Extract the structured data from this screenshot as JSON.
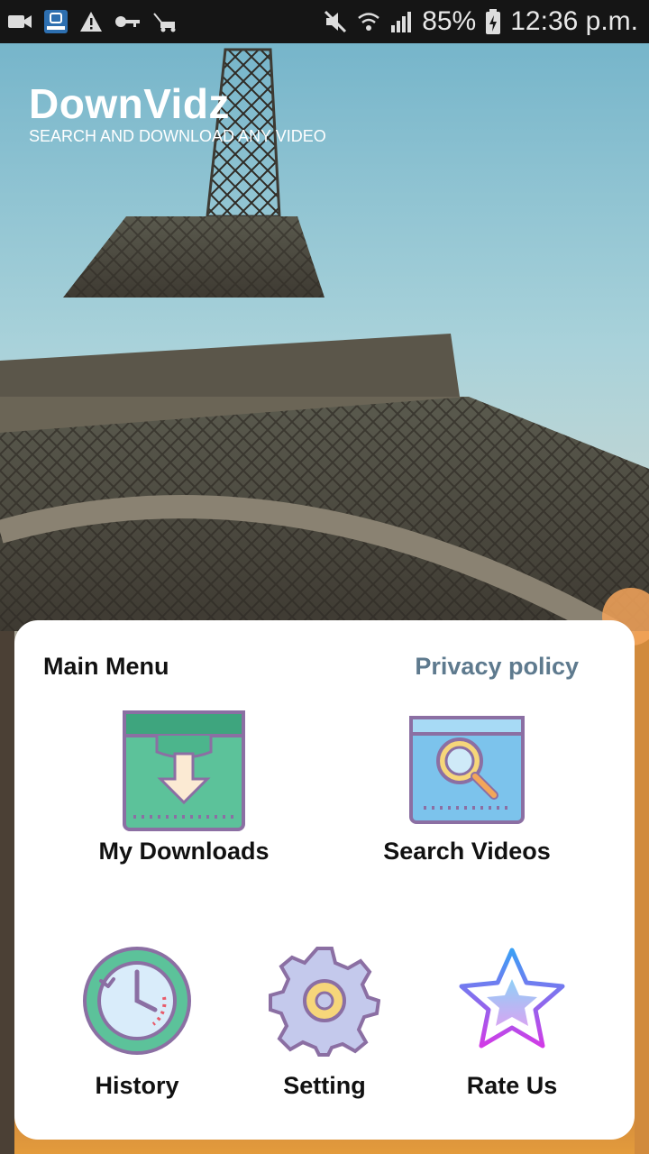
{
  "status_bar": {
    "battery": "85%",
    "time": "12:36 p.m.",
    "icons": [
      "video-camera-icon",
      "insta-app-icon",
      "warning-icon",
      "key-icon",
      "mower-icon",
      "mute-icon",
      "wifi-icon",
      "signal-icon",
      "battery-charging-icon"
    ]
  },
  "app": {
    "title": "DownVidz",
    "subtitle": "SEARCH AND DOWNLOAD ANY VIDEO"
  },
  "menu": {
    "title": "Main Menu",
    "privacy_link": "Privacy policy",
    "items": [
      {
        "label": "My Downloads",
        "icon": "download-box-icon"
      },
      {
        "label": "Search Videos",
        "icon": "search-window-icon"
      },
      {
        "label": "History",
        "icon": "clock-history-icon"
      },
      {
        "label": "Setting",
        "icon": "gear-icon"
      },
      {
        "label": "Rate Us",
        "icon": "star-icon"
      }
    ]
  },
  "colors": {
    "accent_green": "#5cc29a",
    "link": "#5e7a8e",
    "icon_outline": "#8b6fa3"
  }
}
